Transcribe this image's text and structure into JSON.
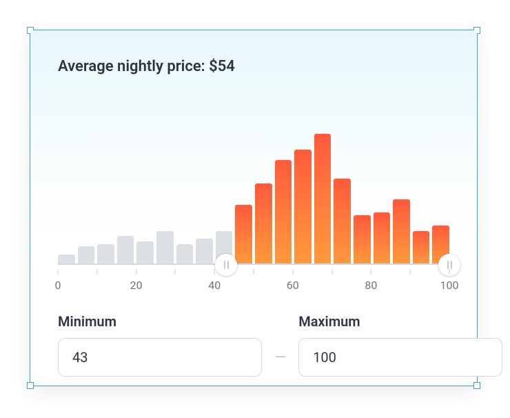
{
  "title_label": "Average nightly price: ",
  "average_price": "$54",
  "axis": {
    "ticks": [
      0,
      10,
      20,
      30,
      40,
      50,
      60,
      70,
      80,
      90,
      100
    ],
    "labels": [
      0,
      20,
      40,
      60,
      80,
      100
    ]
  },
  "range": {
    "min": 43,
    "max": 100,
    "axis_min": 0,
    "axis_max": 100
  },
  "inputs": {
    "min_label": "Minimum",
    "max_label": "Maximum",
    "min_value": "43",
    "max_value": "100",
    "separator": "—"
  },
  "chart_data": {
    "type": "bar",
    "title": "Average nightly price: $54",
    "xlabel": "",
    "ylabel": "",
    "xlim": [
      0,
      100
    ],
    "ylim": [
      0,
      100
    ],
    "categories": [
      2.5,
      7.5,
      12.5,
      17.5,
      22.5,
      27.5,
      32.5,
      37.5,
      42.5,
      47.5,
      52.5,
      57.5,
      62.5,
      67.5,
      72.5,
      77.5,
      82.5,
      87.5,
      92.5,
      97.5
    ],
    "values": [
      8,
      14,
      16,
      22,
      18,
      26,
      16,
      20,
      26,
      46,
      62,
      80,
      88,
      100,
      66,
      38,
      40,
      50,
      26,
      30
    ]
  }
}
